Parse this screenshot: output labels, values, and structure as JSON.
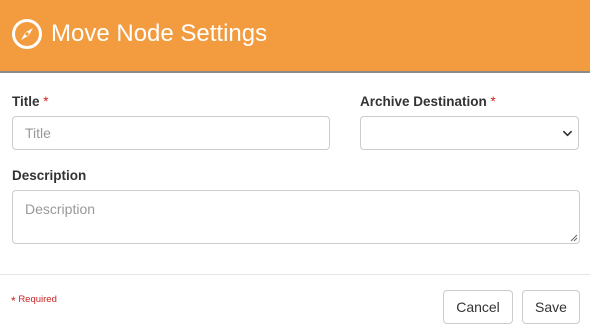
{
  "header": {
    "title": "Move Node Settings",
    "icon": "compass-icon",
    "background": "#f39c3f"
  },
  "form": {
    "title_label": "Title",
    "title_required": "*",
    "title_placeholder": "Title",
    "title_value": "",
    "archive_label": "Archive Destination",
    "archive_required": "*",
    "archive_selected": "",
    "description_label": "Description",
    "description_placeholder": "Description",
    "description_value": ""
  },
  "footer": {
    "required_star": "*",
    "required_text": "Required",
    "cancel_label": "Cancel",
    "save_label": "Save"
  },
  "colors": {
    "accent": "#f39c3f",
    "required": "#cc2222"
  }
}
